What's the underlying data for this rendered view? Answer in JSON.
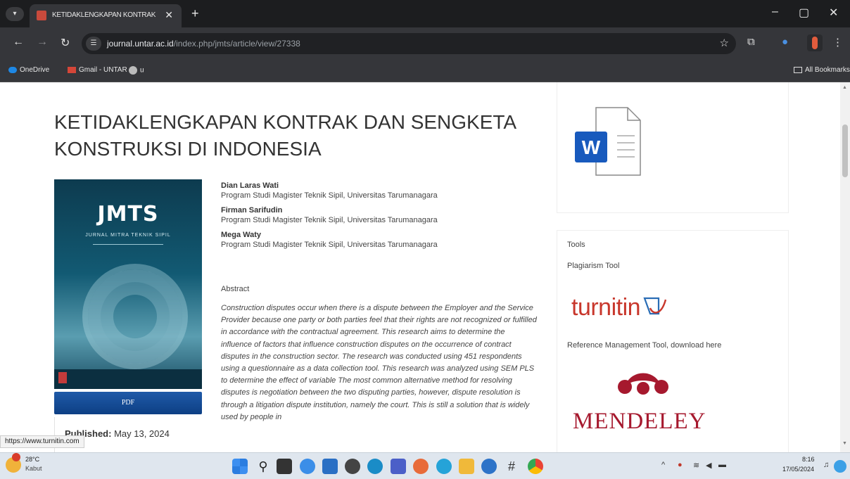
{
  "browser": {
    "tab_title": "KETIDAKLENGKAPAN KONTRAK",
    "url_host": "journal.untar.ac.id",
    "url_path": "/index.php/jmts/article/view/27338",
    "bookmarks": [
      "OneDrive",
      "Gmail - UNTAR",
      "u"
    ],
    "all_bookmarks": "All Bookmarks"
  },
  "article": {
    "title": "KETIDAKLENGKAPAN KONTRAK DAN SENGKETA KONSTRUKSI DI INDONESIA",
    "cover_title": "JMTS",
    "cover_subtitle": "JURNAL MITRA TEKNIK SIPIL",
    "pdf_label": "PDF",
    "published_label": "Published:",
    "published_date": "May 13, 2024",
    "authors": [
      {
        "name": "Dian Laras Wati",
        "affiliation": "Program Studi Magister Teknik Sipil, Universitas Tarumanagara"
      },
      {
        "name": "Firman Sarifudin",
        "affiliation": "Program Studi Magister Teknik Sipil, Universitas Tarumanagara"
      },
      {
        "name": "Mega Waty",
        "affiliation": "Program Studi Magister Teknik Sipil, Universitas Tarumanagara"
      }
    ],
    "abstract_label": "Abstract",
    "abstract": "Construction disputes occur when there is a dispute between the Employer and the Service Provider because one party or both parties feel that their rights are not recognized or fulfilled in accordance with the contractual agreement. This research aims to determine the influence of factors that influence construction disputes on the occurrence of contract disputes in the construction sector. The research was conducted using 451 respondents using a questionnaire as a data collection tool. This research was analyzed using SEM PLS to determine the effect of variable The most common alternative method for resolving disputes is negotiation between the two disputing parties, however, dispute resolution is through a litigation dispute institution, namely the court. This is still a solution that is widely used by people in"
  },
  "sidebar": {
    "doc_letter": "W",
    "tools_label": "Tools",
    "plagiarism_label": "Plagiarism Tool",
    "turnitin_text": "turnitin",
    "reference_label": "Reference Management Tool, download here",
    "mendeley_text": "MENDELEY"
  },
  "status_url": "https://www.turnitin.com",
  "taskbar": {
    "weather_temp": "28°C",
    "weather_desc": "Kabut",
    "time": "8:16",
    "date": "17/05/2024"
  },
  "colors": {
    "word_blue": "#185abd",
    "turnitin_red": "#c8372c",
    "mendeley_red": "#a6192e",
    "pdf_button": "#1f5aa8"
  }
}
